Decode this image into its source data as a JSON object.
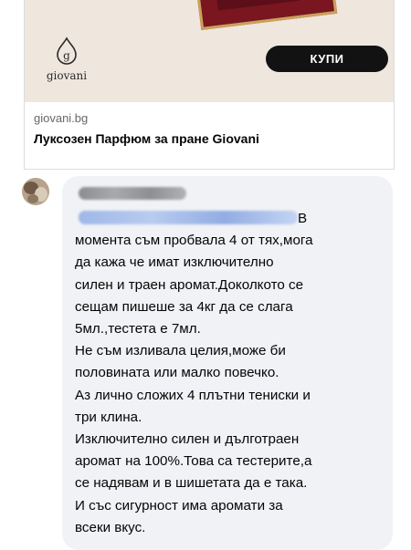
{
  "ad": {
    "logo_text": "giovani",
    "buy_button_label": "КУПИ",
    "domain": "giovani.bg",
    "title": "Луксозен Парфюм за пране Giovani",
    "colors": {
      "banner_bg": "#efe6de",
      "button_bg": "#121212",
      "product": "#7a1620"
    }
  },
  "comment": {
    "avatar_icon": "user-avatar-icon",
    "author_name": "",
    "mention": "",
    "first_line": "В",
    "body": "момента съм пробвала 4 от тях,мога\nда кажа че имат изключително\nсилен и траен аромат.Доколкото се\nсещам пишеше за 4кг да се слага\n5мл.,тестета е 7мл.\nНе съм изливала целия,може би\nполовината или малко повечко.\nАз лично сложих 4 плътни тениски и\nтри клина.\nИзключително силен и дълготраен\nаромат на 100%.Това са тестерите,а\nсе надявам и в шишетата да е така.\nИ със сигурност има аромати за\nвсеки вкус.",
    "colors": {
      "bubble_bg": "#f0f2f5",
      "mention": "#216fdb"
    }
  }
}
